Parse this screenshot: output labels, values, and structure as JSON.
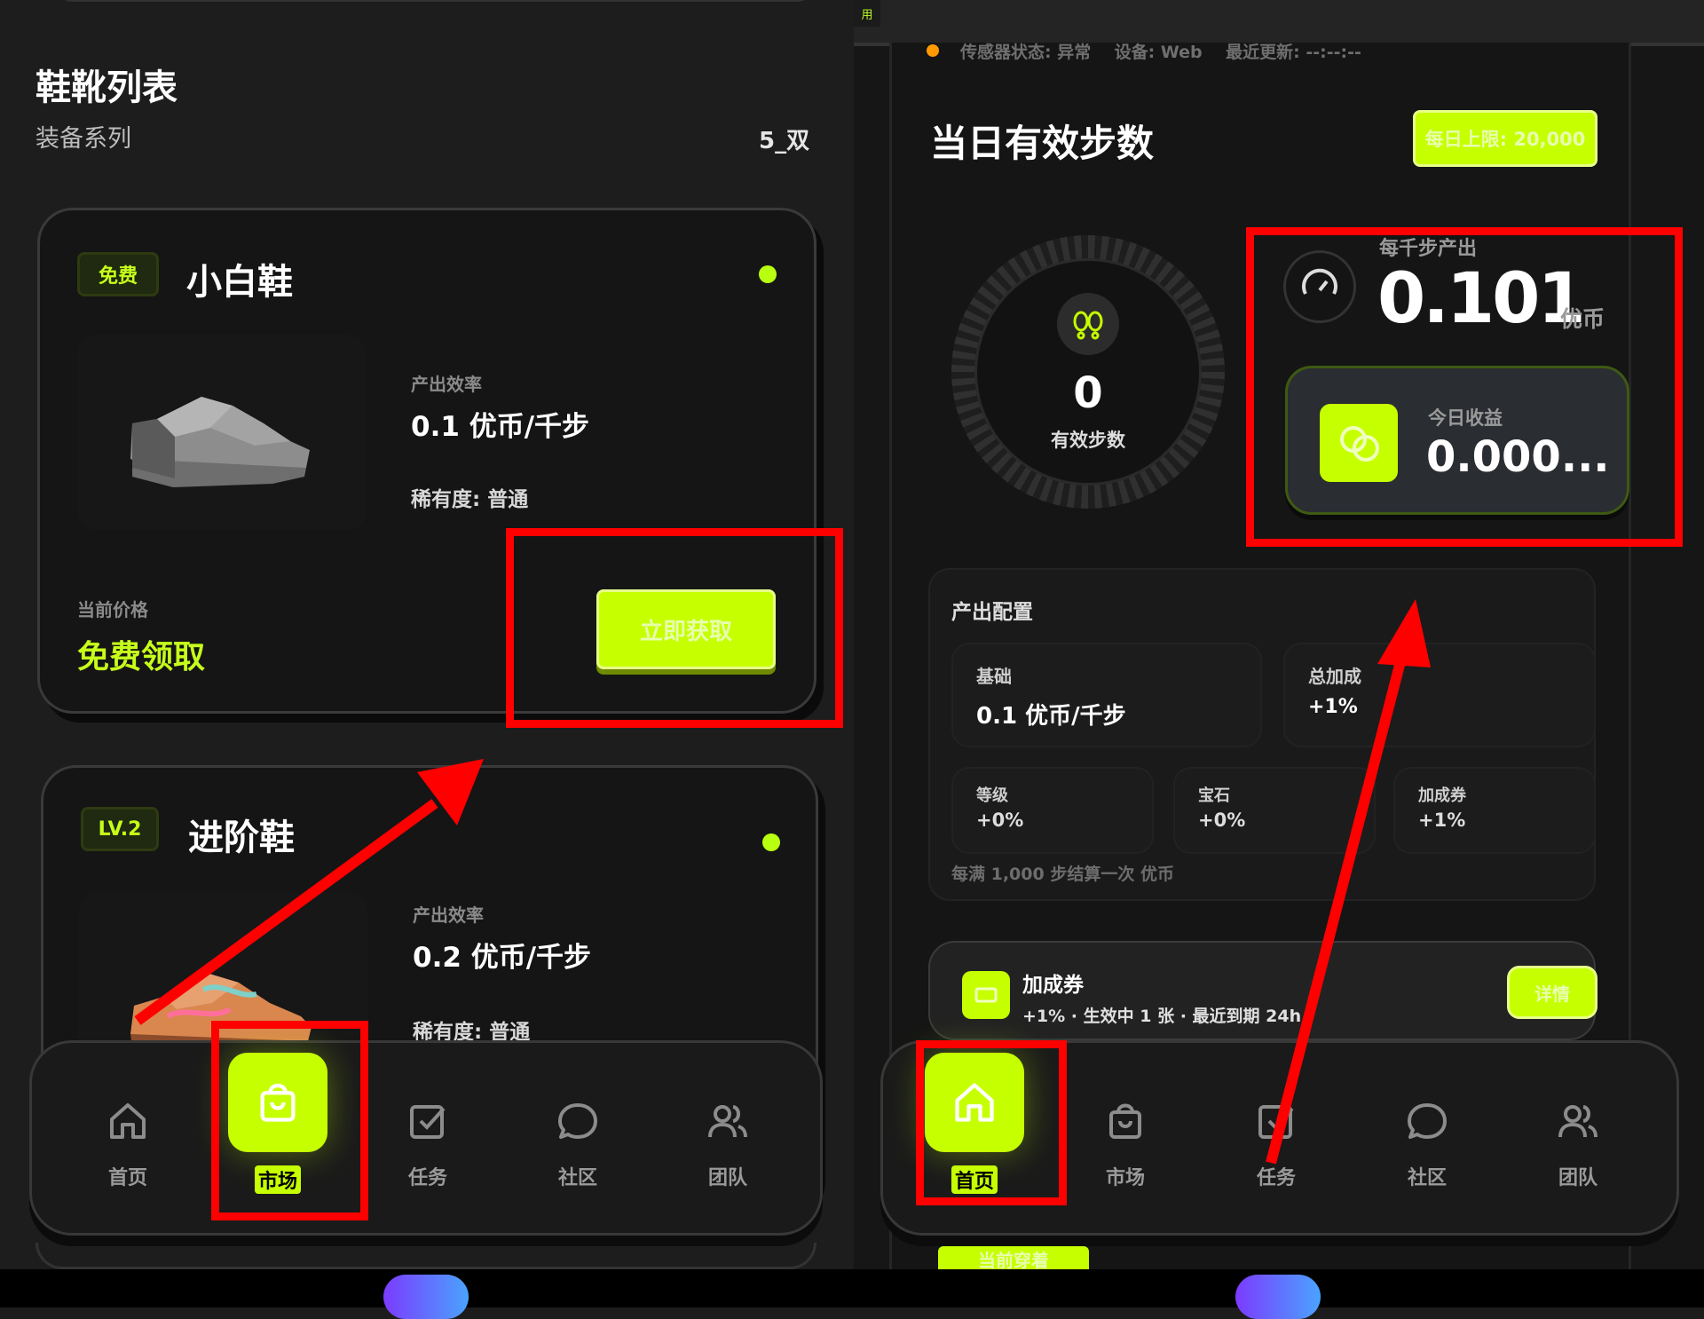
{
  "left": {
    "title": "鞋靴列表",
    "subtitle": "装备系列",
    "count": "5_双",
    "shoes": [
      {
        "badge": "免费",
        "name": "小白鞋",
        "rate_label": "产出效率",
        "rate": "0.1 优币/千步",
        "rarity": "稀有度: 普通",
        "price_label": "当前价格",
        "price": "免费领取",
        "button": "立即获取"
      },
      {
        "badge": "LV.2",
        "name": "进阶鞋",
        "rate_label": "产出效率",
        "rate": "0.2 优币/千步",
        "rarity": "稀有度: 普通"
      }
    ],
    "nav": {
      "items": [
        "首页",
        "市场",
        "任务",
        "社区",
        "团队"
      ],
      "active": "市场"
    }
  },
  "right": {
    "status_line": "传感器状态: 异常    设备: Web    最近更新: --:--:--",
    "header_tab": "用",
    "title": "当日有效步数",
    "limit_button": "每日上限: 20,000",
    "steps": "0",
    "steps_label": "有效步数",
    "per_k_label": "每千步产出",
    "per_k_value": "0.101",
    "per_k_unit": "优币",
    "today_label": "今日收益",
    "today_value": "0.000...",
    "config": {
      "title": "产出配置",
      "base_label": "基础",
      "base_value": "0.1 优币/千步",
      "total_label": "总加成",
      "total_value": "+1%",
      "level_label": "等级",
      "level_value": "+0%",
      "gem_label": "宝石",
      "gem_value": "+0%",
      "coupon_label": "加成券",
      "coupon_value": "+1%",
      "note": "每满 1,000 步结算一次 优币"
    },
    "coupon": {
      "title": "加成券",
      "desc": "+1% · 生效中 1 张 · 最近到期 24h",
      "button": "详情"
    },
    "wearing": "当前穿着",
    "nav": {
      "items": [
        "首页",
        "市场",
        "任务",
        "社区",
        "团队"
      ],
      "active": "首页"
    }
  },
  "colors": {
    "accent": "#c6ff00",
    "annotation": "#ff0000",
    "background": "#1d1d1d"
  }
}
